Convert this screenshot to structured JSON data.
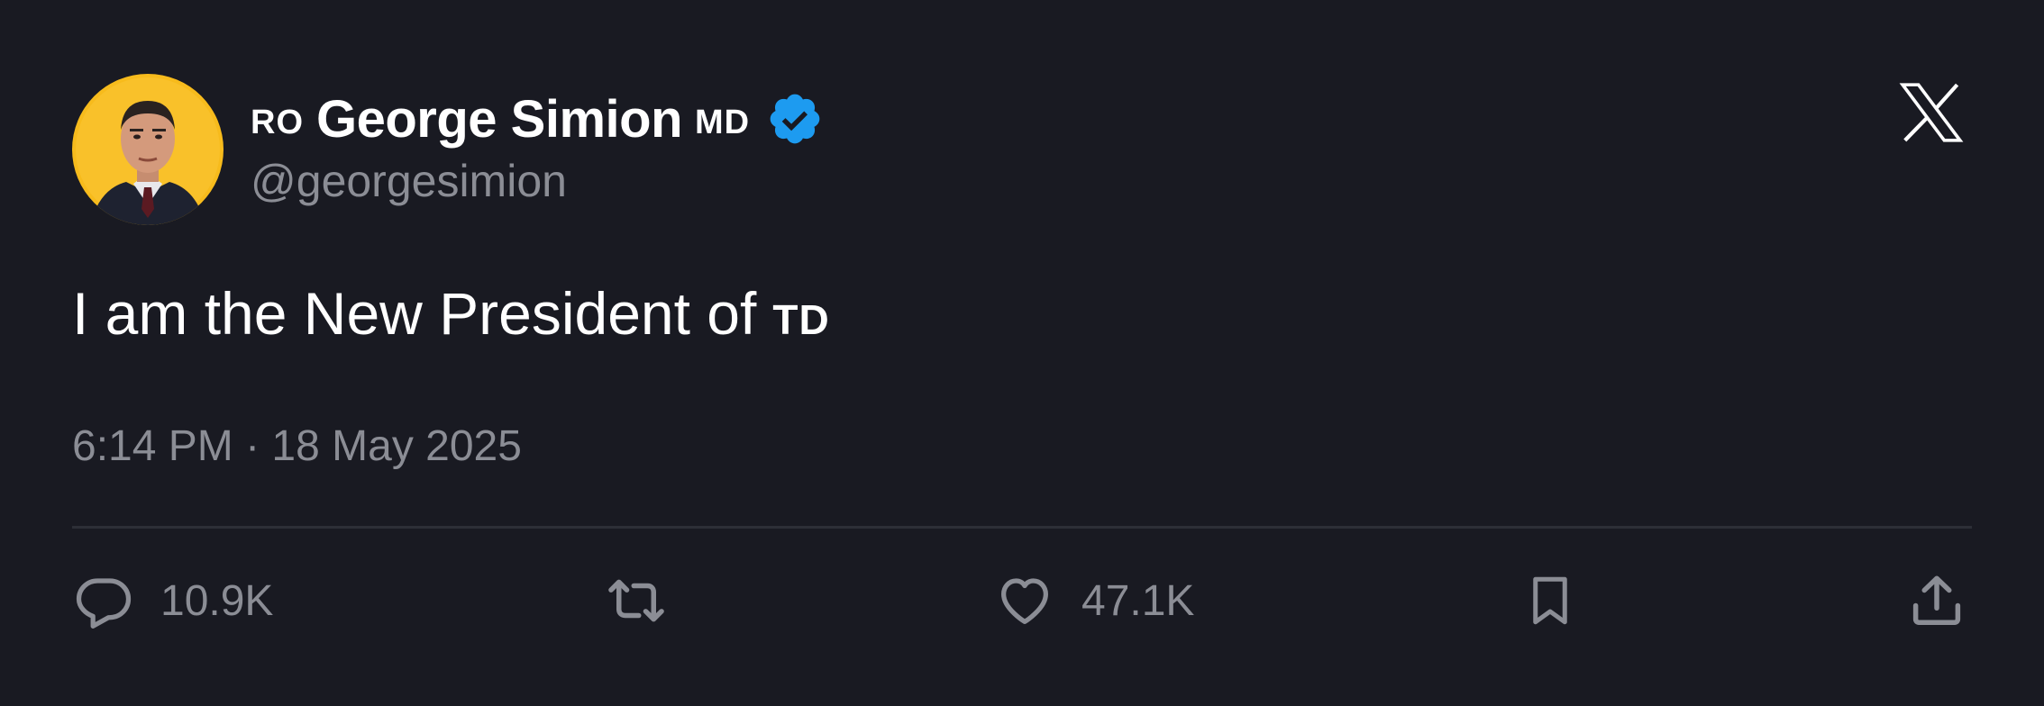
{
  "author": {
    "flag_left": "RO",
    "display_name": "George Simion",
    "flag_right": "MD",
    "handle": "@georgesimion",
    "verified": true,
    "verified_color": "#1d9bf0",
    "avatar_background": "#f7bb1c"
  },
  "platform_logo": "x-logo-icon",
  "tweet": {
    "text": "I am the New President of",
    "flag": "TD"
  },
  "timestamp": "6:14 PM · 18 May 2025",
  "actions": {
    "reply": {
      "icon": "reply-icon",
      "count": "10.9K"
    },
    "retweet": {
      "icon": "retweet-icon"
    },
    "like": {
      "icon": "heart-icon",
      "count": "47.1K"
    },
    "bookmark": {
      "icon": "bookmark-icon"
    },
    "share": {
      "icon": "share-icon"
    }
  },
  "colors": {
    "background": "#191a22",
    "text_primary": "#ffffff",
    "text_secondary": "#8b8d95",
    "divider": "#2d2f37"
  }
}
